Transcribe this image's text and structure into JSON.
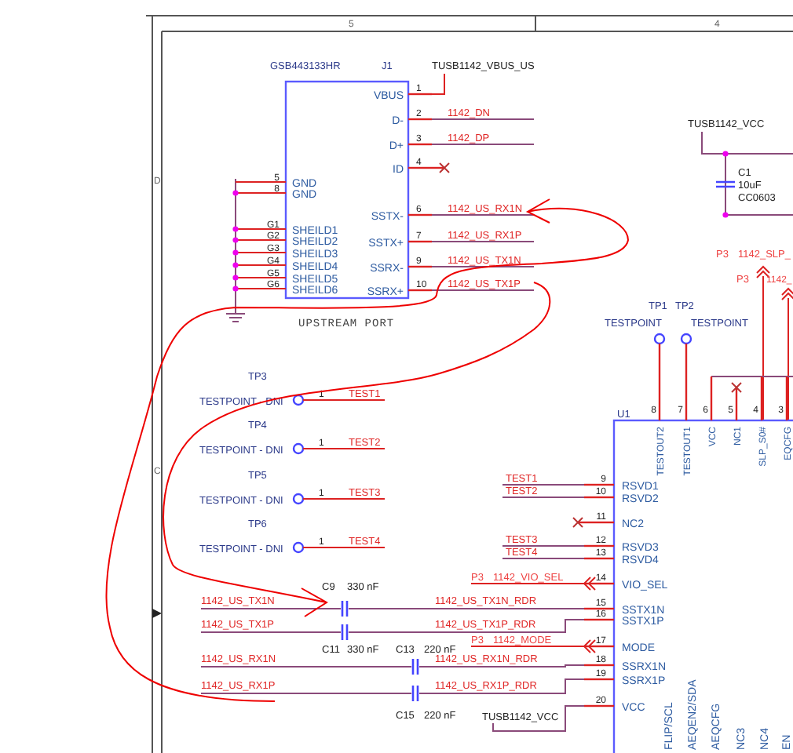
{
  "frame": {
    "column_markers": [
      "5",
      "4"
    ],
    "row_markers": [
      "D",
      "C"
    ]
  },
  "j1": {
    "part_number": "GSB443133HR",
    "ref": "J1",
    "caption": "UPSTREAM PORT",
    "vbus_net": "TUSB1142_VBUS_US",
    "right_pins": [
      {
        "name": "VBUS",
        "number": "1",
        "no_connect": false
      },
      {
        "name": "D-",
        "number": "2",
        "net": "1142_DN",
        "no_connect": false
      },
      {
        "name": "D+",
        "number": "3",
        "net": "1142_DP",
        "no_connect": false
      },
      {
        "name": "ID",
        "number": "4",
        "no_connect": true
      },
      {
        "name": "SSTX-",
        "number": "6",
        "net": "1142_US_RX1N",
        "no_connect": false
      },
      {
        "name": "SSTX+",
        "number": "7",
        "net": "1142_US_RX1P",
        "no_connect": false
      },
      {
        "name": "SSRX-",
        "number": "9",
        "net": "1142_US_TX1N",
        "no_connect": false
      },
      {
        "name": "SSRX+",
        "number": "10",
        "net": "1142_US_TX1P",
        "no_connect": false
      }
    ],
    "left_pins": [
      {
        "name": "GND",
        "number": "5"
      },
      {
        "name": "GND",
        "number": "8"
      },
      {
        "name": "SHEILD1",
        "number": "G1"
      },
      {
        "name": "SHEILD2",
        "number": "G2"
      },
      {
        "name": "SHEILD3",
        "number": "G3"
      },
      {
        "name": "SHEILD4",
        "number": "G4"
      },
      {
        "name": "SHEILD5",
        "number": "G5"
      },
      {
        "name": "SHEILD6",
        "number": "G6"
      }
    ]
  },
  "vcc_cap": {
    "net": "TUSB1142_VCC",
    "ref": "C1",
    "value": "10uF",
    "footprint": "CC0603"
  },
  "offpage": [
    {
      "page": "P3",
      "net": "1142_SLP_"
    },
    {
      "page": "P3",
      "net": "1142_"
    }
  ],
  "top_testpoints": [
    {
      "ref": "TP1",
      "value": "TESTPOINT"
    },
    {
      "ref": "TP2",
      "value": "TESTPOINT"
    }
  ],
  "dni_testpoints": [
    {
      "ref": "TP3",
      "value": "TESTPOINT - DNI",
      "pin": "1",
      "net": "TEST1"
    },
    {
      "ref": "TP4",
      "value": "TESTPOINT - DNI",
      "pin": "1",
      "net": "TEST2"
    },
    {
      "ref": "TP5",
      "value": "TESTPOINT - DNI",
      "pin": "1",
      "net": "TEST3"
    },
    {
      "ref": "TP6",
      "value": "TESTPOINT - DNI",
      "pin": "1",
      "net": "TEST4"
    }
  ],
  "coupling_caps": [
    {
      "ref": "C9",
      "value": "330 nF"
    },
    {
      "ref": "C11",
      "value": "330 nF"
    },
    {
      "ref": "C13",
      "value": "220 nF"
    },
    {
      "ref": "C15",
      "value": "220 nF"
    }
  ],
  "coupling_nets": [
    {
      "input": "1142_US_TX1N",
      "output": "1142_US_TX1N_RDR"
    },
    {
      "input": "1142_US_TX1P",
      "output": "1142_US_TX1P_RDR"
    },
    {
      "input": "1142_US_RX1N",
      "output": "1142_US_RX1N_RDR"
    },
    {
      "input": "1142_US_RX1P",
      "output": "1142_US_RX1P_RDR"
    }
  ],
  "u1": {
    "ref": "U1",
    "top_pins": [
      {
        "number": "8",
        "name": "TESTOUT2",
        "no_connect": false
      },
      {
        "number": "7",
        "name": "TESTOUT1",
        "no_connect": false
      },
      {
        "number": "6",
        "name": "VCC",
        "no_connect": false
      },
      {
        "number": "5",
        "name": "NC1",
        "no_connect": true
      },
      {
        "number": "4",
        "name": "SLP_S0#",
        "no_connect": false
      },
      {
        "number": "3",
        "name": "EQCFG",
        "no_connect": false
      }
    ],
    "left_pins": [
      {
        "number": "9",
        "name": "RSVD1",
        "net": "TEST1",
        "no_connect": false
      },
      {
        "number": "10",
        "name": "RSVD2",
        "net": "TEST2",
        "no_connect": false
      },
      {
        "number": "11",
        "name": "NC2",
        "no_connect": true
      },
      {
        "number": "12",
        "name": "RSVD3",
        "net": "TEST3",
        "no_connect": false
      },
      {
        "number": "13",
        "name": "RSVD4",
        "net": "TEST4",
        "no_connect": false
      },
      {
        "number": "14",
        "name": "VIO_SEL",
        "page": "P3",
        "net": "1142_VIO_SEL",
        "no_connect": false
      },
      {
        "number": "15",
        "name": "SSTX1N",
        "no_connect": false
      },
      {
        "number": "16",
        "name": "SSTX1P",
        "no_connect": false
      },
      {
        "number": "17",
        "name": "MODE",
        "page": "P3",
        "net": "1142_MODE",
        "no_connect": false
      },
      {
        "number": "18",
        "name": "SSRX1N",
        "no_connect": false
      },
      {
        "number": "19",
        "name": "SSRX1P",
        "no_connect": false
      },
      {
        "number": "20",
        "name": "VCC",
        "net": "TUSB1142_VCC",
        "no_connect": false
      }
    ],
    "bottom_pins": [
      "FLIP/SCL",
      "AEQEN2/SDA",
      "AEQCFG",
      "NC3",
      "NC4",
      "EN"
    ]
  }
}
